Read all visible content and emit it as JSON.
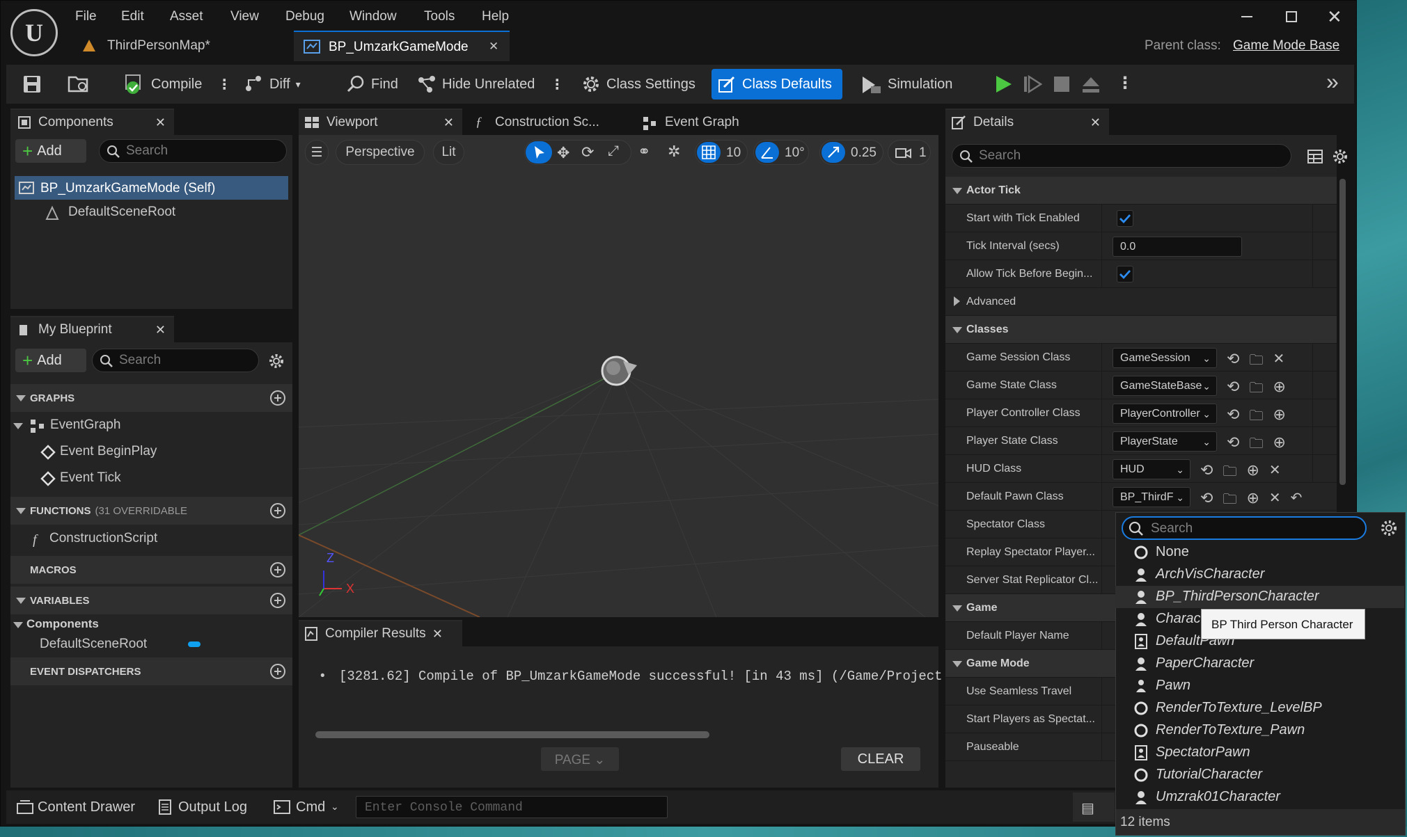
{
  "window": {
    "menu": [
      "File",
      "Edit",
      "Asset",
      "View",
      "Debug",
      "Window",
      "Tools",
      "Help"
    ]
  },
  "tabs": {
    "map": "ThirdPersonMap*",
    "active": "BP_UmzarkGameMode"
  },
  "parent": {
    "label": "Parent class:",
    "value": "Game Mode Base"
  },
  "toolbar": {
    "compile": "Compile",
    "diff": "Diff",
    "find": "Find",
    "hide_unrelated": "Hide Unrelated",
    "class_settings": "Class Settings",
    "class_defaults": "Class Defaults",
    "simulation": "Simulation"
  },
  "components": {
    "tab": "Components",
    "add": "Add",
    "search_placeholder": "Search",
    "self": "BP_UmzarkGameMode (Self)",
    "root": "DefaultSceneRoot"
  },
  "my_blueprint": {
    "tab": "My Blueprint",
    "add": "Add",
    "search_placeholder": "Search",
    "graphs": "GRAPHS",
    "event_graph": "EventGraph",
    "event_begin": "Event BeginPlay",
    "event_tick": "Event Tick",
    "functions": "FUNCTIONS",
    "functions_note": "(31 OVERRIDABLE",
    "construction": "ConstructionScript",
    "macros": "MACROS",
    "variables": "VARIABLES",
    "components_group": "Components",
    "var_root": "DefaultSceneRoot",
    "dispatchers": "EVENT DISPATCHERS"
  },
  "viewport": {
    "tab": "Viewport",
    "tab2": "Construction Sc...",
    "tab3": "Event Graph",
    "perspective": "Perspective",
    "lit": "Lit",
    "grid": "10",
    "angle": "10°",
    "scale": "0.25",
    "cam": "1",
    "axis_x": "X",
    "axis_z": "Z"
  },
  "compiler": {
    "tab": "Compiler Results",
    "message": "[3281.62] Compile of BP_UmzarkGameMode successful! [in 43 ms] (/Game/Project",
    "page": "PAGE",
    "clear": "CLEAR"
  },
  "details": {
    "tab": "Details",
    "search_placeholder": "Search",
    "actor_tick": "Actor Tick",
    "start_tick": "Start with Tick Enabled",
    "tick_interval": "Tick Interval (secs)",
    "tick_interval_value": "0.0",
    "allow_tick": "Allow Tick Before Begin...",
    "advanced": "Advanced",
    "classes": "Classes",
    "game_session": "Game Session Class",
    "game_session_v": "GameSession",
    "game_state": "Game State Class",
    "game_state_v": "GameStateBase",
    "player_controller": "Player Controller Class",
    "player_controller_v": "PlayerController",
    "player_state": "Player State Class",
    "player_state_v": "PlayerState",
    "hud": "HUD Class",
    "hud_v": "HUD",
    "default_pawn": "Default Pawn Class",
    "default_pawn_v": "BP_ThirdF",
    "spectator": "Spectator Class",
    "replay": "Replay Spectator Player...",
    "server_stat": "Server Stat Replicator Cl...",
    "game": "Game",
    "default_player_name": "Default Player Name",
    "game_mode": "Game Mode",
    "seamless": "Use Seamless Travel",
    "start_spectators": "Start Players as Spectat...",
    "pauseable": "Pauseable"
  },
  "picker": {
    "search_placeholder": "Search",
    "items": [
      "None",
      "ArchVisCharacter",
      "BP_ThirdPersonCharacter",
      "Charac",
      "DefaultPawn",
      "PaperCharacter",
      "Pawn",
      "RenderToTexture_LevelBP",
      "RenderToTexture_Pawn",
      "SpectatorPawn",
      "TutorialCharacter",
      "Umzrak01Character"
    ],
    "count": "12 items",
    "tooltip": "BP Third Person Character"
  },
  "statusbar": {
    "content_drawer": "Content Drawer",
    "output_log": "Output Log",
    "cmd": "Cmd",
    "console_placeholder": "Enter Console Command"
  },
  "colors": {
    "accent": "#0a70d6",
    "play": "#4cc742",
    "panel": "#242424"
  }
}
